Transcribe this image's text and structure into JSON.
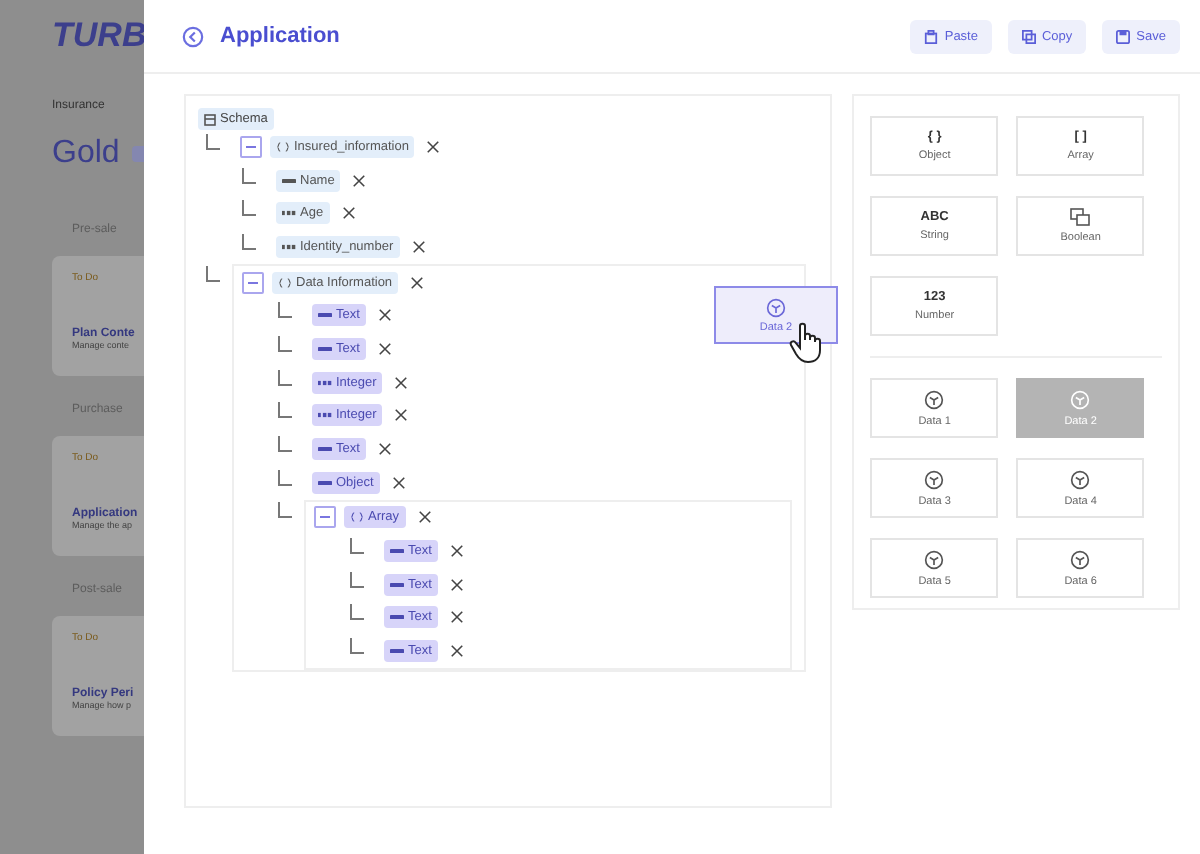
{
  "background_page": {
    "logo": "TURB",
    "breadcrumb": "Insurance",
    "title": "Gold",
    "sections": [
      {
        "label": "Pre-sale",
        "card": {
          "status": "To Do",
          "title": "Plan Conte",
          "description": "Manage conte"
        }
      },
      {
        "label": "Purchase",
        "card": {
          "status": "To Do",
          "title": "Application",
          "description": "Manage the ap"
        }
      },
      {
        "label": "Post-sale",
        "card": {
          "status": "To Do",
          "title": "Policy Peri",
          "description": "Manage how p"
        }
      }
    ]
  },
  "drawer": {
    "title": "Application",
    "actions": [
      {
        "label": "Paste",
        "kind": "paste"
      },
      {
        "label": "Copy",
        "kind": "copy"
      },
      {
        "label": "Save",
        "kind": "save"
      }
    ]
  },
  "schema": {
    "root": "Schema",
    "children": [
      {
        "label": "Insured_information",
        "kind": "object",
        "expanded": true,
        "framed": false,
        "highlighted": false,
        "children": [
          {
            "label": "Name",
            "kind": "text",
            "highlighted": false
          },
          {
            "label": "Age",
            "kind": "number",
            "highlighted": false
          },
          {
            "label": "Identity_number",
            "kind": "number",
            "highlighted": false
          }
        ]
      },
      {
        "label": "Data Information",
        "kind": "object",
        "expanded": true,
        "framed": true,
        "highlighted": false,
        "children": [
          {
            "label": "Text",
            "kind": "text",
            "highlighted": true
          },
          {
            "label": "Text",
            "kind": "text",
            "highlighted": true
          },
          {
            "label": "Integer",
            "kind": "number",
            "highlighted": true
          },
          {
            "label": "Integer",
            "kind": "number",
            "highlighted": true
          },
          {
            "label": "Text",
            "kind": "text",
            "highlighted": true
          },
          {
            "label": "Object",
            "kind": "text",
            "highlighted": true
          },
          {
            "label": "Array",
            "kind": "object",
            "expanded": true,
            "framed": true,
            "highlighted": true,
            "children": [
              {
                "label": "Text",
                "kind": "text",
                "highlighted": true
              },
              {
                "label": "Text",
                "kind": "text",
                "highlighted": true
              },
              {
                "label": "Text",
                "kind": "text",
                "highlighted": true
              },
              {
                "label": "Text",
                "kind": "text",
                "highlighted": true
              }
            ]
          }
        ]
      }
    ]
  },
  "dragged_item": {
    "label": "Data 2"
  },
  "palette": {
    "types": [
      {
        "glyph": "{ }",
        "label": "Object",
        "kind": "glyph"
      },
      {
        "glyph": "[ ]",
        "label": "Array",
        "kind": "glyph"
      },
      {
        "glyph": "ABC",
        "label": "String",
        "kind": "glyph"
      },
      {
        "label": "Boolean",
        "kind": "toggle"
      },
      {
        "glyph": "123",
        "label": "Number",
        "kind": "glyph"
      }
    ],
    "data": [
      {
        "label": "Data 1",
        "disabled": false
      },
      {
        "label": "Data 2",
        "disabled": true
      },
      {
        "label": "Data 3",
        "disabled": false
      },
      {
        "label": "Data 4",
        "disabled": false
      },
      {
        "label": "Data 5",
        "disabled": false
      },
      {
        "label": "Data 6",
        "disabled": false
      }
    ]
  }
}
